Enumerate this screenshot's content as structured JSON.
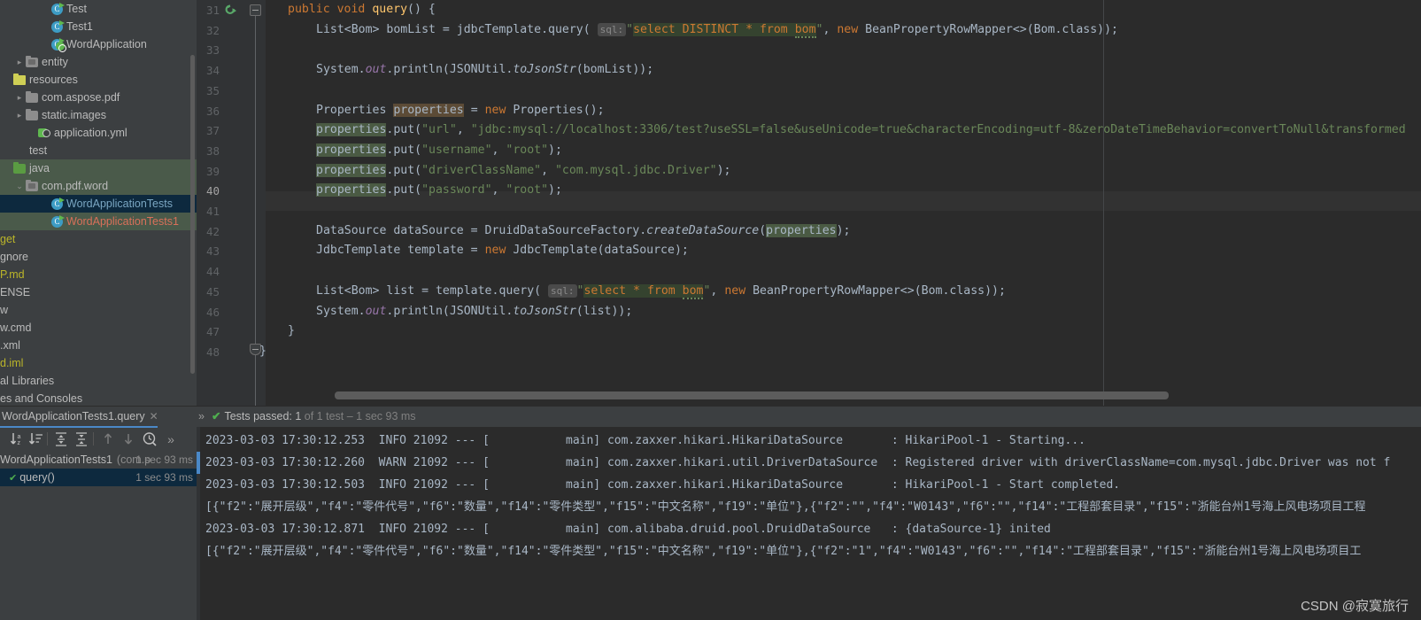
{
  "project_tree": {
    "items": [
      {
        "label": "Test",
        "indent": 3,
        "icon": "java-class-icon",
        "color": "c-norm",
        "twisty": "",
        "row_state": ""
      },
      {
        "label": "Test1",
        "indent": 3,
        "icon": "java-class-icon",
        "color": "c-norm",
        "twisty": "",
        "row_state": ""
      },
      {
        "label": "WordApplication",
        "indent": 3,
        "icon": "spring-boot-class-icon",
        "color": "c-norm",
        "twisty": "",
        "row_state": ""
      },
      {
        "label": "entity",
        "indent": 1,
        "icon": "package-folder-icon",
        "color": "c-norm",
        "twisty": "▸",
        "row_state": ""
      },
      {
        "label": "resources",
        "indent": 0,
        "icon": "resources-folder-icon",
        "color": "c-norm",
        "twisty": "",
        "row_state": ""
      },
      {
        "label": "com.aspose.pdf",
        "indent": 1,
        "icon": "folder-icon",
        "color": "c-norm",
        "twisty": "▸",
        "row_state": ""
      },
      {
        "label": "static.images",
        "indent": 1,
        "icon": "folder-icon",
        "color": "c-norm",
        "twisty": "▸",
        "row_state": ""
      },
      {
        "label": "application.yml",
        "indent": 2,
        "icon": "yml-file-icon",
        "color": "c-norm",
        "twisty": "",
        "row_state": ""
      },
      {
        "label": "test",
        "indent": 0,
        "icon": "none",
        "color": "c-norm",
        "twisty": "",
        "row_state": "",
        "clipped": true
      },
      {
        "label": "java",
        "indent": 0,
        "icon": "source-folder-icon",
        "color": "c-norm",
        "twisty": "",
        "row_state": "hl-green",
        "clipped": true
      },
      {
        "label": "com.pdf.word",
        "indent": 1,
        "icon": "package-folder-icon",
        "color": "c-norm",
        "twisty": "⌄",
        "row_state": "hl-green"
      },
      {
        "label": "WordApplicationTests",
        "indent": 3,
        "icon": "java-class-icon",
        "color": "c-blue",
        "twisty": "",
        "row_state": "sel-blue"
      },
      {
        "label": "WordApplicationTests1",
        "indent": 3,
        "icon": "java-class-icon",
        "color": "c-red",
        "twisty": "",
        "row_state": "hl-green"
      }
    ],
    "clipped_items": [
      {
        "label": "get",
        "color": "c-yellow",
        "row_state": "hl-brown"
      },
      {
        "label": "gnore",
        "color": "c-norm",
        "row_state": ""
      },
      {
        "label": "P.md",
        "color": "c-yellow",
        "row_state": ""
      },
      {
        "label": "ENSE",
        "color": "c-norm",
        "row_state": ""
      },
      {
        "label": "w",
        "color": "c-norm",
        "row_state": ""
      },
      {
        "label": "w.cmd",
        "color": "c-norm",
        "row_state": ""
      },
      {
        "label": ".xml",
        "color": "c-norm",
        "row_state": ""
      },
      {
        "label": "d.iml",
        "color": "c-yellow",
        "row_state": ""
      },
      {
        "label": "al Libraries",
        "color": "c-norm",
        "row_state": ""
      },
      {
        "label": "es and Consoles",
        "color": "c-norm",
        "row_state": ""
      }
    ]
  },
  "editor": {
    "current_line": 40,
    "lines": [
      {
        "no": 31,
        "indent": 0
      },
      {
        "no": 32,
        "indent": 0
      },
      {
        "no": 33,
        "indent": 0
      },
      {
        "no": 34,
        "indent": 0
      },
      {
        "no": 35,
        "indent": 0
      },
      {
        "no": 36,
        "indent": 0
      },
      {
        "no": 37,
        "indent": 0
      },
      {
        "no": 38,
        "indent": 0
      },
      {
        "no": 39,
        "indent": 0
      },
      {
        "no": 40,
        "indent": 0
      },
      {
        "no": 41,
        "indent": 0
      },
      {
        "no": 42,
        "indent": 0
      },
      {
        "no": 43,
        "indent": 0
      },
      {
        "no": 44,
        "indent": 0
      },
      {
        "no": 45,
        "indent": 0
      },
      {
        "no": 46,
        "indent": 0
      },
      {
        "no": 47,
        "indent": 0
      },
      {
        "no": 48,
        "indent": 0
      }
    ],
    "code": {
      "l31_public": "public",
      "l31_void": "void",
      "l31_query": "query",
      "l31_tail": "() {",
      "l32_a": "List<Bom> bomList = jdbcTemplate.",
      "l32_query": "query",
      "l32_paren": "( ",
      "l32_hint": "sql:",
      "l32_q1": "\"",
      "l32_sql": "select DISTINCT * from ",
      "l32_sqltbl": "bom",
      "l32_q2": "\"",
      "l32_comma": ", ",
      "l32_new": "new",
      "l32_tail": " BeanPropertyRowMapper<>(Bom.class));",
      "l34_a": "System.",
      "l34_out": "out",
      "l34_b": ".println(JSONUtil.",
      "l34_m": "toJsonStr",
      "l34_c": "(bomList));",
      "l36_a": "Properties ",
      "l36_decl": "properties",
      "l36_b": " = ",
      "l36_new": "new",
      "l36_c": " Properties();",
      "l37_use": "properties",
      "l37_a": ".put(",
      "l37_s1": "\"url\"",
      "l37_b": ", ",
      "l37_s2": "\"jdbc:mysql://localhost:3306/test?useSSL=false&useUnicode=true&characterEncoding=utf-8&zeroDateTimeBehavior=convertToNull&transformed",
      "l38_use": "properties",
      "l38_a": ".put(",
      "l38_s1": "\"username\"",
      "l38_b": ", ",
      "l38_s2": "\"root\"",
      "l38_c": ");",
      "l39_use": "properties",
      "l39_a": ".put(",
      "l39_s1": "\"driverClassName\"",
      "l39_b": ", ",
      "l39_s2": "\"com.mysql.jdbc.Driver\"",
      "l39_c": ");",
      "l40_use": "properties",
      "l40_a": ".put(",
      "l40_s1": "\"password\"",
      "l40_b": ", ",
      "l40_s2": "\"root\"",
      "l40_c": ");",
      "l42_a": "DataSource dataSource = DruidDataSourceFactory.",
      "l42_m": "createDataSource",
      "l42_b": "(",
      "l42_use": "properties",
      "l42_c": ");",
      "l43_a": "JdbcTemplate template = ",
      "l43_new": "new",
      "l43_b": " JdbcTemplate(dataSource);",
      "l45_a": "List<Bom> list = template.",
      "l45_query": "query",
      "l45_paren": "( ",
      "l45_hint": "sql:",
      "l45_q1": "\"",
      "l45_sql": "select * from ",
      "l45_sqltbl": "bom",
      "l45_q2": "\"",
      "l45_comma": ", ",
      "l45_new": "new",
      "l45_tail": " BeanPropertyRowMapper<>(Bom.class));",
      "l46_a": "System.",
      "l46_out": "out",
      "l46_b": ".println(JSONUtil.",
      "l46_m": "toJsonStr",
      "l46_c": "(list));",
      "l47_brace": "}",
      "l48_brace": "}"
    }
  },
  "run_window": {
    "tab_label": "WordApplicationTests1.query",
    "tab_close": "✕",
    "toolbar": {
      "sort_alpha_label": "Sort alphabetically",
      "sort_duration_label": "Sort by duration",
      "expand_all_label": "Expand All",
      "collapse_all_label": "Collapse All",
      "prev_label": "Previous Occurrence",
      "next_label": "Next Occurrence",
      "history_label": "Test History",
      "more_label": "»"
    },
    "status": {
      "check": "✔",
      "passed_text": "Tests passed: 1",
      "detail_text": " of 1 test – 1 sec 93 ms",
      "chevron": "»"
    },
    "tests": [
      {
        "label": "WordApplicationTests1",
        "sub": "(com.p",
        "time": "1 sec 93 ms",
        "selected": false
      },
      {
        "label": "query()",
        "sub": "",
        "time": "1 sec 93 ms",
        "selected": true
      }
    ]
  },
  "console": {
    "lines": [
      {
        "type": "log",
        "text": "2023-03-03 17:30:12.253  INFO 21092 --- [           main] com.zaxxer.hikari.HikariDataSource       : HikariPool-1 - Starting...",
        "marker": false
      },
      {
        "type": "log",
        "text": "2023-03-03 17:30:12.260  WARN 21092 --- [           main] com.zaxxer.hikari.util.DriverDataSource  : Registered driver with driverClassName=com.mysql.jdbc.Driver was not f",
        "marker": true
      },
      {
        "type": "log",
        "text": "2023-03-03 17:30:12.503  INFO 21092 --- [           main] com.zaxxer.hikari.HikariDataSource       : HikariPool-1 - Start completed.",
        "marker": false
      },
      {
        "type": "json",
        "text": "[{\"f2\":\"展开层级\",\"f4\":\"零件代号\",\"f6\":\"数量\",\"f14\":\"零件类型\",\"f15\":\"中文名称\",\"f19\":\"单位\"},{\"f2\":\"\",\"f4\":\"W0143\",\"f6\":\"\",\"f14\":\"工程部套目录\",\"f15\":\"浙能台州1号海上风电场项目工程",
        "marker": false
      },
      {
        "type": "log",
        "text": "2023-03-03 17:30:12.871  INFO 21092 --- [           main] com.alibaba.druid.pool.DruidDataSource   : {dataSource-1} inited",
        "marker": false
      },
      {
        "type": "json",
        "text": "[{\"f2\":\"展开层级\",\"f4\":\"零件代号\",\"f6\":\"数量\",\"f14\":\"零件类型\",\"f15\":\"中文名称\",\"f19\":\"单位\"},{\"f2\":\"1\",\"f4\":\"W0143\",\"f6\":\"\",\"f14\":\"工程部套目录\",\"f15\":\"浙能台州1号海上风电场项目工",
        "marker": false
      }
    ]
  },
  "watermark": {
    "text": "CSDN @寂寞旅行"
  },
  "colors": {
    "editor_bg": "#2b2b2b",
    "panel_bg": "#3c3f41",
    "selection_blue": "#0d293e",
    "accent_blue": "#4a88c7",
    "string_green": "#6a8759",
    "keyword_orange": "#cc7832",
    "method_yellow": "#ffc66d",
    "field_purple": "#9876aa",
    "pass_green": "#4fae4f",
    "error_red": "#d9705a"
  }
}
